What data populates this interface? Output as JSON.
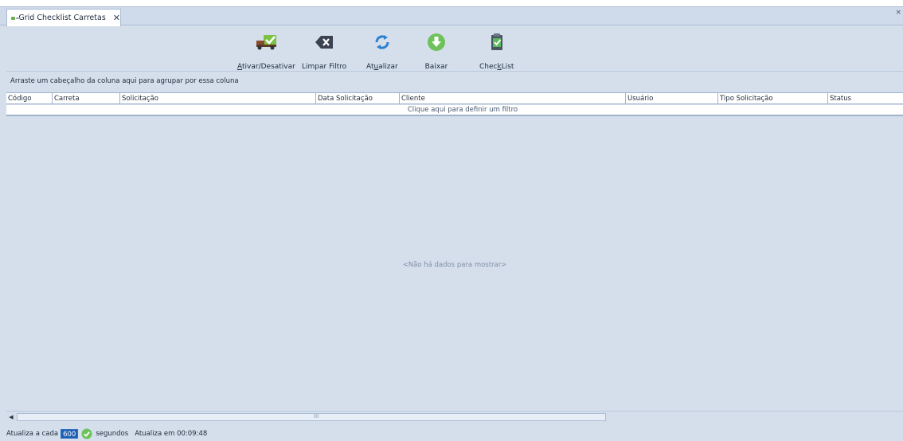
{
  "tab": {
    "title": "Grid Checklist Carretas",
    "close_glyph": "✕"
  },
  "window": {
    "close_glyph": "×"
  },
  "toolbar": {
    "buttons": [
      {
        "label": "Ativar/Desativar",
        "icon": "truck-check-icon"
      },
      {
        "label": "Limpar Filtro",
        "icon": "clear-filter-icon"
      },
      {
        "label": "Atualizar",
        "icon": "refresh-icon"
      },
      {
        "label": "Baixar",
        "icon": "download-icon"
      },
      {
        "label": "CheckList",
        "icon": "checklist-icon"
      }
    ]
  },
  "group_panel": {
    "text": "Arraste um cabeçalho da coluna aqui para agrupar por essa coluna"
  },
  "grid": {
    "columns": [
      "Código",
      "Carreta",
      "Solicitação",
      "Data Solicitação",
      "Cliente",
      "Usuário",
      "Tipo Solicitação",
      "Status"
    ],
    "filter_prompt": "Clique aqui para definir um filtro",
    "empty_text": "<Não há dados para mostrar>",
    "scroll_left_glyph": "◀",
    "scroll_grip_glyph": "III"
  },
  "statusbar": {
    "refresh_prefix": "Atualiza a cada",
    "refresh_value": "600",
    "refresh_suffix": "segundos",
    "next_update": "Atualiza em 00:09:48"
  },
  "colors": {
    "background": "#d5dfec",
    "accent_green": "#7cc242",
    "accent_blue": "#2d7fd0",
    "selection_blue": "#1a5fb4"
  }
}
